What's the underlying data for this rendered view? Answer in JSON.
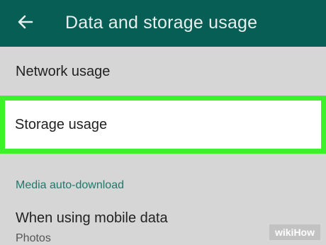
{
  "app_bar": {
    "title": "Data and storage usage",
    "back_icon": "arrow-left-icon",
    "background": "#075e54"
  },
  "list": {
    "network_usage": "Network usage",
    "storage_usage": "Storage usage",
    "highlight_color": "#3df22a"
  },
  "media_section": {
    "header": "Media auto-download",
    "mobile_data": {
      "label": "When using mobile data",
      "value": "Photos"
    }
  },
  "watermark": {
    "part1": "wiki",
    "part2": "How"
  }
}
